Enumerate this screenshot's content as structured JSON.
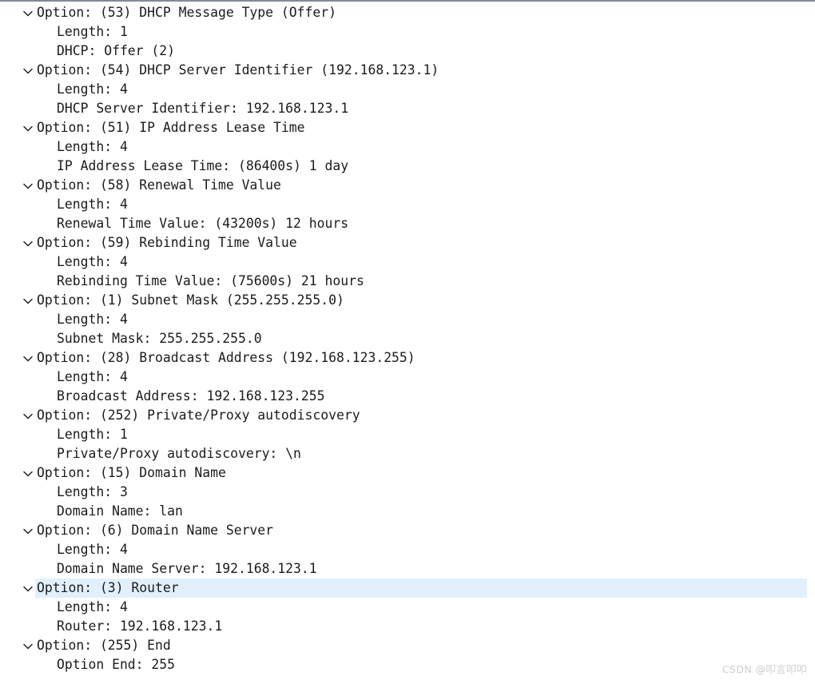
{
  "pane": {
    "name": "dhcp-option-tree",
    "selected_row_index": 30,
    "colors": {
      "background": "#ffffff",
      "text": "#1b1b1b",
      "selection": "#e2f0fd",
      "top_border": "#808a99",
      "watermark": "#cdcdcd"
    },
    "twisty_icon": "chevron-down-icon"
  },
  "watermark": {
    "text": "CSDN @叩言叩叩"
  },
  "rows": [
    {
      "indent": 0,
      "twisty": true,
      "text": "Option: (53) DHCP Message Type (Offer)"
    },
    {
      "indent": 1,
      "twisty": false,
      "text": "Length: 1"
    },
    {
      "indent": 1,
      "twisty": false,
      "text": "DHCP: Offer (2)"
    },
    {
      "indent": 0,
      "twisty": true,
      "text": "Option: (54) DHCP Server Identifier (192.168.123.1)"
    },
    {
      "indent": 1,
      "twisty": false,
      "text": "Length: 4"
    },
    {
      "indent": 1,
      "twisty": false,
      "text": "DHCP Server Identifier: 192.168.123.1"
    },
    {
      "indent": 0,
      "twisty": true,
      "text": "Option: (51) IP Address Lease Time"
    },
    {
      "indent": 1,
      "twisty": false,
      "text": "Length: 4"
    },
    {
      "indent": 1,
      "twisty": false,
      "text": "IP Address Lease Time: (86400s) 1 day"
    },
    {
      "indent": 0,
      "twisty": true,
      "text": "Option: (58) Renewal Time Value"
    },
    {
      "indent": 1,
      "twisty": false,
      "text": "Length: 4"
    },
    {
      "indent": 1,
      "twisty": false,
      "text": "Renewal Time Value: (43200s) 12 hours"
    },
    {
      "indent": 0,
      "twisty": true,
      "text": "Option: (59) Rebinding Time Value"
    },
    {
      "indent": 1,
      "twisty": false,
      "text": "Length: 4"
    },
    {
      "indent": 1,
      "twisty": false,
      "text": "Rebinding Time Value: (75600s) 21 hours"
    },
    {
      "indent": 0,
      "twisty": true,
      "text": "Option: (1) Subnet Mask (255.255.255.0)"
    },
    {
      "indent": 1,
      "twisty": false,
      "text": "Length: 4"
    },
    {
      "indent": 1,
      "twisty": false,
      "text": "Subnet Mask: 255.255.255.0"
    },
    {
      "indent": 0,
      "twisty": true,
      "text": "Option: (28) Broadcast Address (192.168.123.255)"
    },
    {
      "indent": 1,
      "twisty": false,
      "text": "Length: 4"
    },
    {
      "indent": 1,
      "twisty": false,
      "text": "Broadcast Address: 192.168.123.255"
    },
    {
      "indent": 0,
      "twisty": true,
      "text": "Option: (252) Private/Proxy autodiscovery"
    },
    {
      "indent": 1,
      "twisty": false,
      "text": "Length: 1"
    },
    {
      "indent": 1,
      "twisty": false,
      "text": "Private/Proxy autodiscovery: \\n"
    },
    {
      "indent": 0,
      "twisty": true,
      "text": "Option: (15) Domain Name"
    },
    {
      "indent": 1,
      "twisty": false,
      "text": "Length: 3"
    },
    {
      "indent": 1,
      "twisty": false,
      "text": "Domain Name: lan"
    },
    {
      "indent": 0,
      "twisty": true,
      "text": "Option: (6) Domain Name Server"
    },
    {
      "indent": 1,
      "twisty": false,
      "text": "Length: 4"
    },
    {
      "indent": 1,
      "twisty": false,
      "text": "Domain Name Server: 192.168.123.1"
    },
    {
      "indent": 0,
      "twisty": true,
      "text": "Option: (3) Router",
      "selected": true
    },
    {
      "indent": 1,
      "twisty": false,
      "text": "Length: 4"
    },
    {
      "indent": 1,
      "twisty": false,
      "text": "Router: 192.168.123.1"
    },
    {
      "indent": 0,
      "twisty": true,
      "text": "Option: (255) End"
    },
    {
      "indent": 1,
      "twisty": false,
      "text": "Option End: 255"
    }
  ]
}
